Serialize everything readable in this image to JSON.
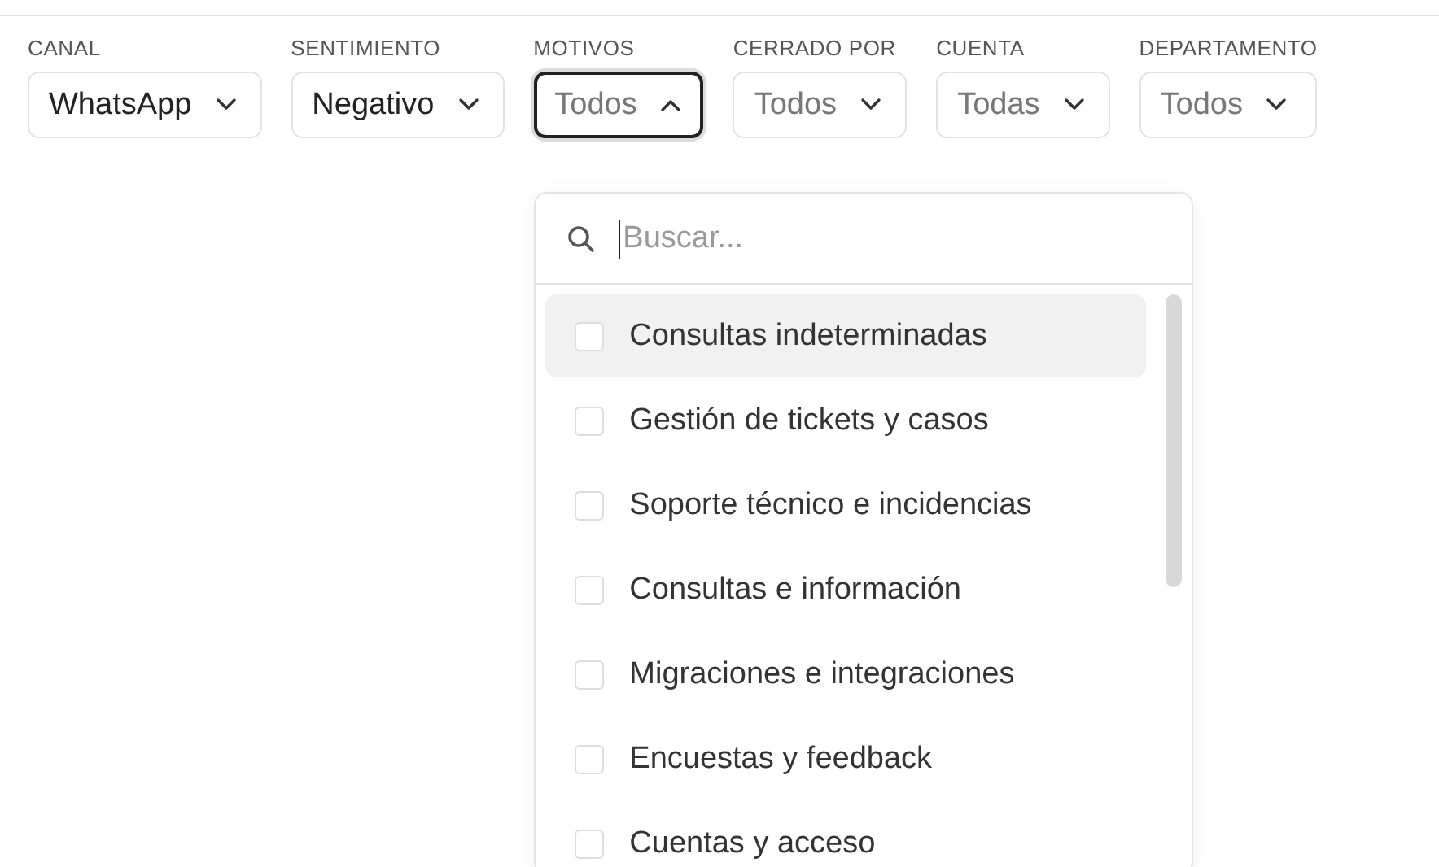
{
  "filters": [
    {
      "label": "CANAL",
      "value": "WhatsApp",
      "open": false
    },
    {
      "label": "SENTIMIENTO",
      "value": "Negativo",
      "open": false
    },
    {
      "label": "MOTIVOS",
      "placeholder": "Todos",
      "open": true
    },
    {
      "label": "CERRADO POR",
      "placeholder": "Todos",
      "open": false
    },
    {
      "label": "CUENTA",
      "placeholder": "Todas",
      "open": false
    },
    {
      "label": "DEPARTAMENTO",
      "placeholder": "Todos",
      "open": false
    }
  ],
  "dropdown": {
    "search": {
      "placeholder": "Buscar..."
    },
    "options": [
      {
        "label": "Consultas indeterminadas",
        "checked": false,
        "highlighted": true
      },
      {
        "label": "Gestión de tickets y casos",
        "checked": false,
        "highlighted": false
      },
      {
        "label": "Soporte técnico e incidencias",
        "checked": false,
        "highlighted": false
      },
      {
        "label": "Consultas e información",
        "checked": false,
        "highlighted": false
      },
      {
        "label": "Migraciones e integraciones",
        "checked": false,
        "highlighted": false
      },
      {
        "label": "Encuestas y feedback",
        "checked": false,
        "highlighted": false
      },
      {
        "label": "Cuentas y acceso",
        "checked": false,
        "highlighted": false
      }
    ]
  }
}
